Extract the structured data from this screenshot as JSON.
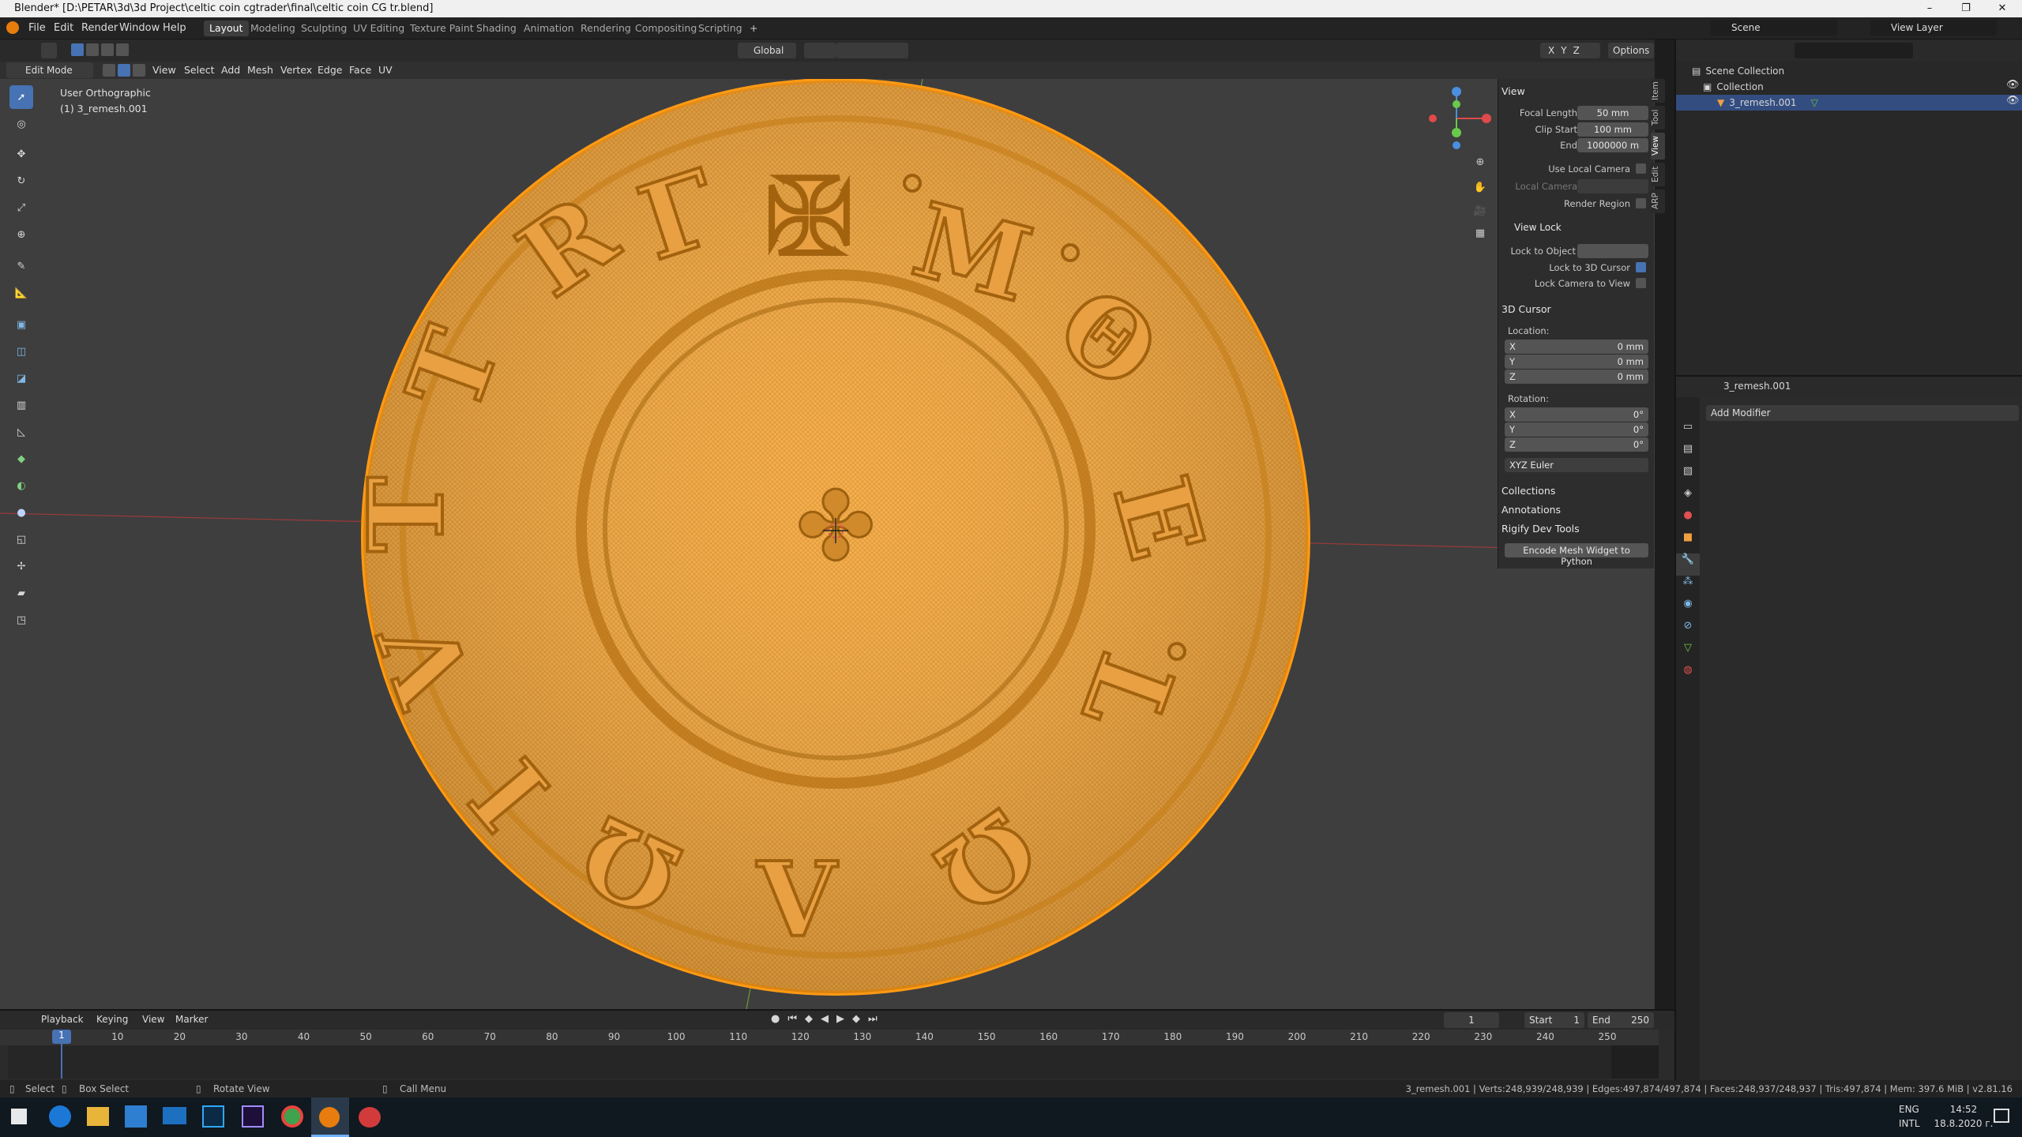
{
  "titlebar": {
    "title": "Blender* [D:\\PETAR\\3d\\3d Project\\celtic coin cgtrader\\final\\celtic coin CG tr.blend]"
  },
  "menu": [
    "File",
    "Edit",
    "Render",
    "Window",
    "Help"
  ],
  "workspaces": [
    "Layout",
    "Modeling",
    "Sculpting",
    "UV Editing",
    "Texture Paint",
    "Shading",
    "Animation",
    "Rendering",
    "Compositing",
    "Scripting"
  ],
  "scene": {
    "name": "Scene",
    "view_layer": "View Layer"
  },
  "header": {
    "transform": "Global",
    "options": "Options",
    "xyz": [
      "X",
      "Y",
      "Z"
    ]
  },
  "viewport_header": {
    "mode": "Edit Mode",
    "menus": [
      "View",
      "Select",
      "Add",
      "Mesh",
      "Vertex",
      "Edge",
      "Face",
      "UV"
    ]
  },
  "viewport": {
    "view_name": "User Orthographic",
    "object_name": "(1) 3_remesh.001"
  },
  "npanel": {
    "tabs": [
      "Item",
      "Tool",
      "View",
      "Edit",
      "ARP"
    ],
    "view_header": "View",
    "focal_label": "Focal Length",
    "focal_value": "50 mm",
    "clip_start_label": "Clip Start",
    "clip_start_value": "100 mm",
    "clip_end_label": "End",
    "clip_end_value": "1000000 m",
    "use_local_camera": "Use Local Camera",
    "local_camera": "Local Camera",
    "render_region": "Render Region",
    "view_lock_header": "View Lock",
    "lock_to_object": "Lock to Object",
    "lock_3d_cursor": "Lock to 3D Cursor",
    "lock_camera": "Lock Camera to View",
    "cursor_header": "3D Cursor",
    "location_label": "Location:",
    "loc": [
      {
        "axis": "X",
        "value": "0 mm"
      },
      {
        "axis": "Y",
        "value": "0 mm"
      },
      {
        "axis": "Z",
        "value": "0 mm"
      }
    ],
    "rotation_label": "Rotation:",
    "rot": [
      {
        "axis": "X",
        "value": "0°"
      },
      {
        "axis": "Y",
        "value": "0°"
      },
      {
        "axis": "Z",
        "value": "0°"
      }
    ],
    "rotation_mode": "XYZ Euler",
    "collections": "Collections",
    "annotations": "Annotations",
    "rigify": "Rigify Dev Tools",
    "encode_btn": "Encode Mesh Widget to Python"
  },
  "outliner": {
    "scene_collection": "Scene Collection",
    "collection": "Collection",
    "object": "3_remesh.001"
  },
  "properties": {
    "object": "3_remesh.001",
    "add_modifier": "Add Modifier"
  },
  "timeline": {
    "menus": [
      "Playback",
      "Keying",
      "View",
      "Marker"
    ],
    "current_frame": "1",
    "start_label": "Start",
    "start": "1",
    "end_label": "End",
    "end": "250",
    "ticks": [
      "1",
      "10",
      "20",
      "30",
      "40",
      "50",
      "60",
      "70",
      "80",
      "90",
      "100",
      "110",
      "120",
      "130",
      "140",
      "150",
      "160",
      "170",
      "180",
      "190",
      "200",
      "210",
      "220",
      "230",
      "240",
      "250"
    ]
  },
  "statusbar": {
    "select": "Select",
    "box_select": "Box Select",
    "rotate_view": "Rotate View",
    "call_menu": "Call Menu",
    "stats": "3_remesh.001 | Verts:248,939/248,939 | Edges:497,874/497,874 | Faces:248,937/248,937 | Tris:497,874 | Mem: 397.6 MiB | v2.81.16"
  },
  "taskbar": {
    "lang": "ENG",
    "intl": "INTL",
    "time": "14:52",
    "date": "18.8.2020 г."
  },
  "colors": {
    "accent": "#4772b3",
    "coin": "#f3a63a",
    "coin_wire": "#d98a1d",
    "selected_orange": "#ff9f1a"
  }
}
